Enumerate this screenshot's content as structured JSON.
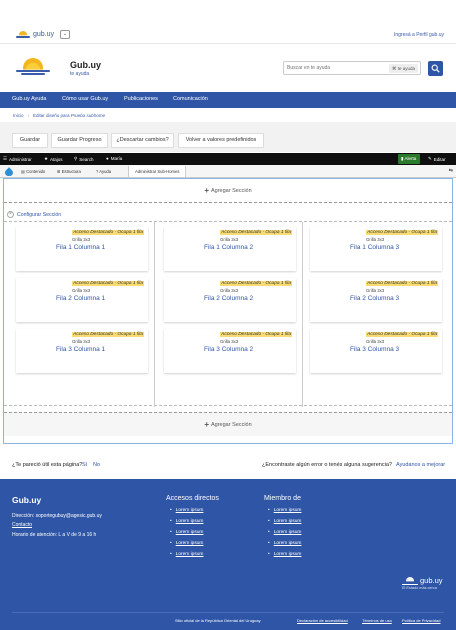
{
  "topbar": {
    "brand": "gub.uy",
    "dropdown_icon": "chevron-down-icon",
    "login": "Ingresá a Perfil gub.uy"
  },
  "header": {
    "site_title": "Gub.uy",
    "site_subtitle": "te ayuda",
    "search_placeholder": "Buscar en te ayuda",
    "search_chip": "te ayuda"
  },
  "nav": [
    "Gub.uy Ayuda",
    "Cómo usar Gub.uy",
    "Publicaciones",
    "Comunicación"
  ],
  "breadcrumb": {
    "home": "Inicio",
    "current_prefix": "Editar diseño para ",
    "current_italic": "Prueba subhome"
  },
  "actions": [
    "Guardar",
    "Guardar Progreso",
    "¿Descartar cambios?",
    "Volver a valores predefinidos"
  ],
  "toolbar": {
    "admin": "Administrar",
    "atajos": "Atajos",
    "search": "Search",
    "user": "María",
    "alerta": "Alerta",
    "editar": "Editar"
  },
  "tray": {
    "contenido": "Contenido",
    "estructura": "Estructura",
    "ayuda": "Ayuda",
    "tab": "Administrar Sub-Homes",
    "corner": "⇆"
  },
  "builder": {
    "add_section": "Agregar Sección",
    "configure": "Configurar Sección",
    "card_badge": "Acceso Destacado - Ocupa 1 fila",
    "card_grid": "Grilla 3x3",
    "cards": [
      "Fila 1 Columna 1",
      "Fila 1 Columna 2",
      "Fila 1 Columna 3",
      "Fila 2 Columna 1",
      "Fila 2 Columna 2",
      "Fila 2 Columna 3",
      "Fila 3 Columna 1",
      "Fila 3 Columna 2",
      "Fila 3 Columna 3"
    ]
  },
  "feedback": {
    "question": "¿Te pareció útil esta página?",
    "yes": "Sí",
    "no": "No",
    "question2": "¿Encontraste algún error o tenés alguna sugerencia?",
    "help": "Ayudanos a mejorar"
  },
  "footer": {
    "title": "Gub.uy",
    "direccion": "Dirección: soportegubuy@agesic.gub.uy",
    "contacto": "Contacto",
    "horario": "Horario de atención: L a V de 9 a 16 h",
    "accesos_title": "Accesos directos",
    "accesos": [
      "Lorem ipsum",
      "Lorem ipsum",
      "Lorem ipsum",
      "Lorem ipsum",
      "Lorem ipsum"
    ],
    "miembro_title": "Miembro de",
    "miembro": [
      "Lorem ipsum",
      "Lorem ipsum",
      "Lorem ipsum",
      "Lorem ipsum",
      "Lorem ipsum"
    ],
    "logo_text": "gub.uy",
    "logo_tagline": "El Estado más cerca",
    "official": "Sitio oficial de la República Oriental del Uruguay",
    "accesibilidad": "Declaración de accesibilidad",
    "terminos": "Términos de uso",
    "privacidad": "Política de Privacidad"
  },
  "colors": {
    "primary": "#2f56a6",
    "toolbar": "#0f0f0f",
    "badge": "#f8dc73",
    "sun": "#f3b61f"
  }
}
